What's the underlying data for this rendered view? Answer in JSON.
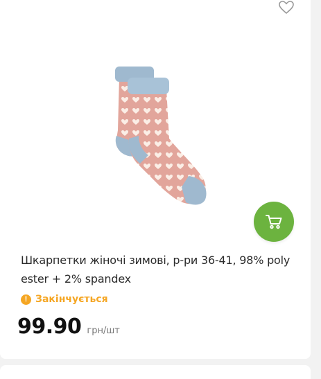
{
  "product": {
    "title": "Шкарпетки жіночі зимові, р-ри 36-41, 98% polyester + 2% spandex",
    "status_text": "Закінчується",
    "status_icon": "exclamation-icon",
    "price": "99.90",
    "unit": "грн/шт",
    "image": "pink-socks-with-hearts"
  },
  "actions": {
    "wishlist_icon": "heart-outline-icon",
    "cart_icon": "cart-icon"
  },
  "colors": {
    "accent_green": "#6cb33f",
    "status_orange": "#f5a623",
    "sock_pink": "#e2a59b",
    "sock_blue": "#9fb9cf"
  }
}
